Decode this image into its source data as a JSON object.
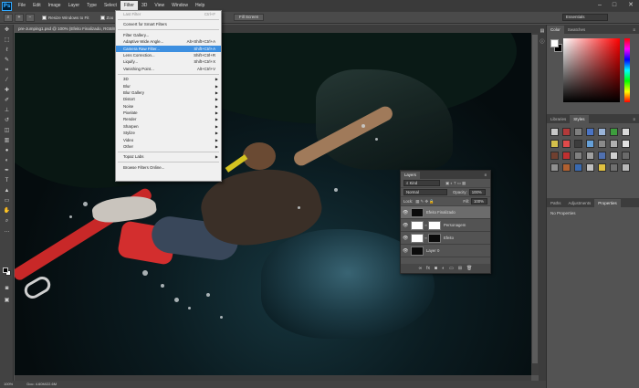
{
  "app": {
    "logo_text": "Ps"
  },
  "menubar": {
    "items": [
      "File",
      "Edit",
      "Image",
      "Layer",
      "Type",
      "Select",
      "Filter",
      "3D",
      "View",
      "Window",
      "Help"
    ],
    "active_index": 6
  },
  "options": {
    "resize_windows_label": "Resize Windows to Fit",
    "zoom_all_label": "Zoo",
    "fill_screen_label": "Fill Screen",
    "workspace_label": "Essentials"
  },
  "document": {
    "tab_label": "pre-Jumping1.psd @ 100% (Efeito Finalizado, RGB/8",
    "status_zoom": "100%",
    "status_doc": "Doc: 4.60M/22.6M"
  },
  "filter_menu": {
    "items": [
      {
        "label": "Last Filter",
        "shortcut": "Ctrl+F",
        "disabled": true
      },
      {
        "sep": true
      },
      {
        "label": "Convert for Smart Filters"
      },
      {
        "sep": true
      },
      {
        "label": "Filter Gallery..."
      },
      {
        "label": "Adaptive Wide Angle...",
        "shortcut": "Alt+Shift+Ctrl+A"
      },
      {
        "label": "Camera Raw Filter...",
        "shortcut": "Shift+Ctrl+A",
        "highlight": true
      },
      {
        "label": "Lens Correction...",
        "shortcut": "Shift+Ctrl+R"
      },
      {
        "label": "Liquify...",
        "shortcut": "Shift+Ctrl+X"
      },
      {
        "label": "Vanishing Point...",
        "shortcut": "Alt+Ctrl+V"
      },
      {
        "sep": true
      },
      {
        "label": "3D",
        "submenu": true
      },
      {
        "label": "Blur",
        "submenu": true
      },
      {
        "label": "Blur Gallery",
        "submenu": true
      },
      {
        "label": "Distort",
        "submenu": true
      },
      {
        "label": "Noise",
        "submenu": true
      },
      {
        "label": "Pixelate",
        "submenu": true
      },
      {
        "label": "Render",
        "submenu": true
      },
      {
        "label": "Sharpen",
        "submenu": true
      },
      {
        "label": "Stylize",
        "submenu": true
      },
      {
        "label": "Video",
        "submenu": true
      },
      {
        "label": "Other",
        "submenu": true
      },
      {
        "sep": true
      },
      {
        "label": "Topaz Labs",
        "submenu": true
      },
      {
        "sep": true
      },
      {
        "label": "Browse Filters Online..."
      }
    ]
  },
  "dock": {
    "color_tabs": [
      "Color",
      "Swatches"
    ],
    "styles_tabs": [
      "Libraries",
      "Styles"
    ],
    "props_tabs": [
      "Paths",
      "Adjustments",
      "Properties"
    ],
    "props_body": "No Properties",
    "style_colors": [
      "#c8c8c8",
      "#b23a3a",
      "#7f7f7f",
      "#4b74c4",
      "#9ab4d8",
      "#3d9d3d",
      "#d8d8d8",
      "#d4c04b",
      "#e04a4a",
      "#3c3c3c",
      "#66a0d8",
      "#8a8a8a",
      "#b0b0b0",
      "#e0e0e0",
      "#704030",
      "#c03030",
      "#808080",
      "#a0a0a0",
      "#5070b0",
      "#d0d0d0",
      "#6a6a6a",
      "#909090",
      "#b06030",
      "#3a6ab0",
      "#c0c0c0",
      "#e0c040",
      "#707070",
      "#b8b8b8"
    ]
  },
  "layers": {
    "tab_label": "Layers",
    "kind_label": "Kind",
    "blend_mode": "Normal",
    "opacity_label": "Opacity:",
    "opacity_value": "100%",
    "lock_label": "Lock:",
    "fill_label": "Fill:",
    "fill_value": "100%",
    "rows": [
      {
        "name": "Efeito Finalizado",
        "selected": true,
        "thumbs": [
          "black"
        ]
      },
      {
        "name": "Personagem",
        "selected": false,
        "thumbs": [
          "white",
          "white"
        ]
      },
      {
        "name": "Efeito",
        "selected": false,
        "thumbs": [
          "white",
          "black"
        ]
      },
      {
        "name": "Layer 0",
        "selected": false,
        "thumbs": [
          "black"
        ]
      }
    ]
  }
}
